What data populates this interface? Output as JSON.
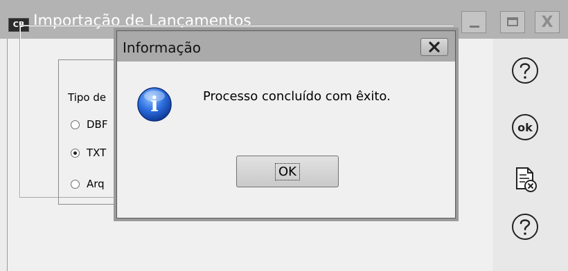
{
  "main_window": {
    "app_badge": "CB",
    "title": "Importação de Lançamentos",
    "controls": {
      "minimize": "_",
      "maximize": "□",
      "close": "X"
    }
  },
  "group": {
    "legend": "Tipo de",
    "options": [
      {
        "label": "DBF",
        "checked": false
      },
      {
        "label": "TXT",
        "checked": true
      },
      {
        "label": "Arq",
        "checked": false
      }
    ]
  },
  "toolbar": {
    "icons": [
      "help-icon",
      "ok-icon",
      "cancel-document-icon",
      "help-icon"
    ],
    "ok_text": "ok"
  },
  "dialog": {
    "title": "Informação",
    "close_label": "X",
    "icon": "info-icon",
    "icon_letter": "i",
    "message": "Processo concluído com êxito.",
    "ok_label": "OK"
  },
  "colors": {
    "titlebar": "#b3b3b3",
    "dialog_titlebar": "#aaaaaa",
    "info_blue": "#1f5fd1"
  }
}
